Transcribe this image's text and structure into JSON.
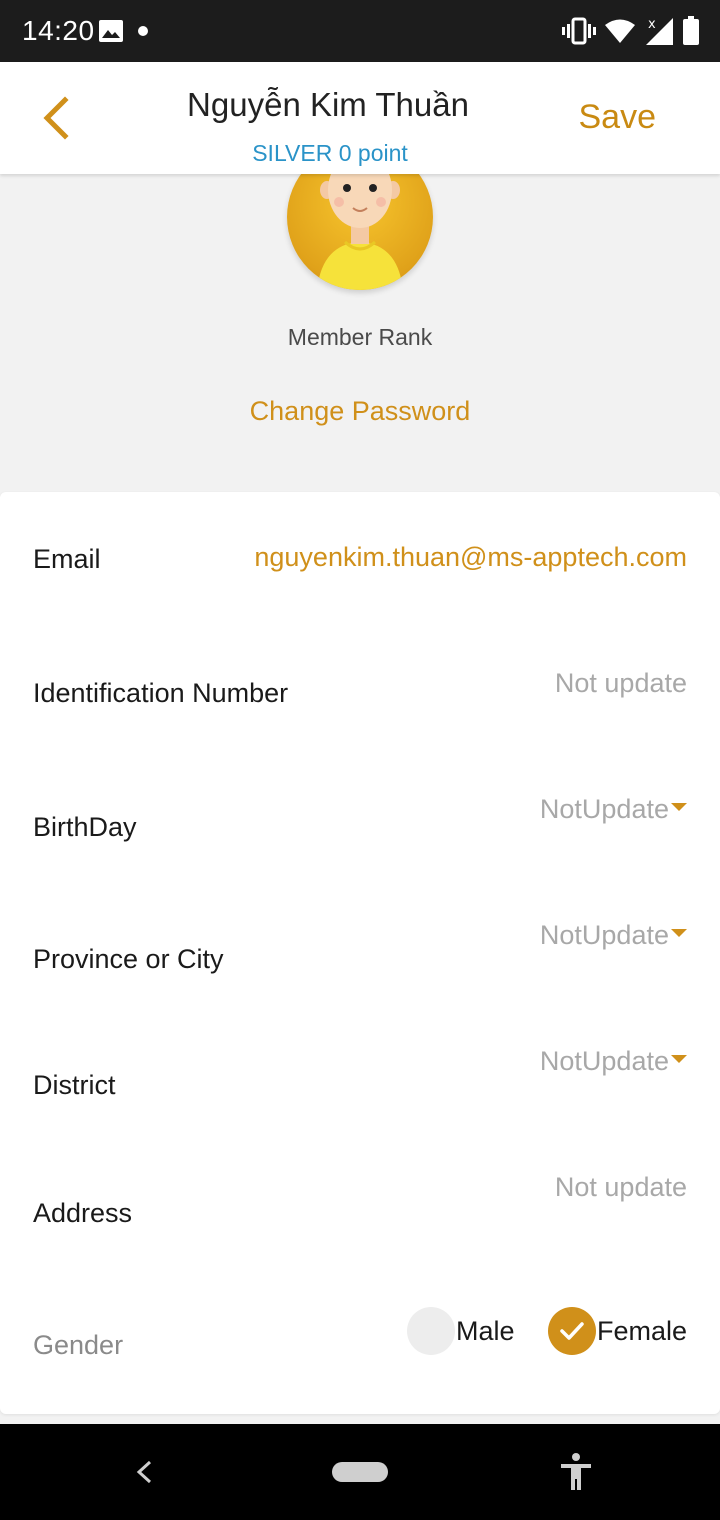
{
  "status_bar": {
    "time": "14:20",
    "icons": [
      "image-icon",
      "notification-dot-icon",
      "vibrate-icon",
      "wifi-icon",
      "signal-icon",
      "battery-icon"
    ]
  },
  "header": {
    "title": "Nguyễn Kim Thuần",
    "subtitle": "SILVER 0 point",
    "save_label": "Save",
    "back_icon": "chevron-left-icon"
  },
  "profile": {
    "member_rank_label": "Member Rank",
    "change_password_label": "Change Password"
  },
  "fields": {
    "email": {
      "label": "Email",
      "value": "nguyenkim.thuan@ms-apptech.com"
    },
    "identification": {
      "label": "Identification Number",
      "value": "Not update"
    },
    "birthday": {
      "label": "BirthDay",
      "value": "NotUpdate"
    },
    "province": {
      "label": "Province or City",
      "value": "NotUpdate"
    },
    "district": {
      "label": "District",
      "value": "NotUpdate"
    },
    "address": {
      "label": "Address",
      "value": "Not update"
    }
  },
  "gender": {
    "label": "Gender",
    "options": [
      {
        "label": "Male",
        "selected": false
      },
      {
        "label": "Female",
        "selected": true
      }
    ]
  },
  "colors": {
    "accent": "#d0901a",
    "subtitle_blue": "#2a93c8",
    "status_bar": "#1c1c1c"
  }
}
